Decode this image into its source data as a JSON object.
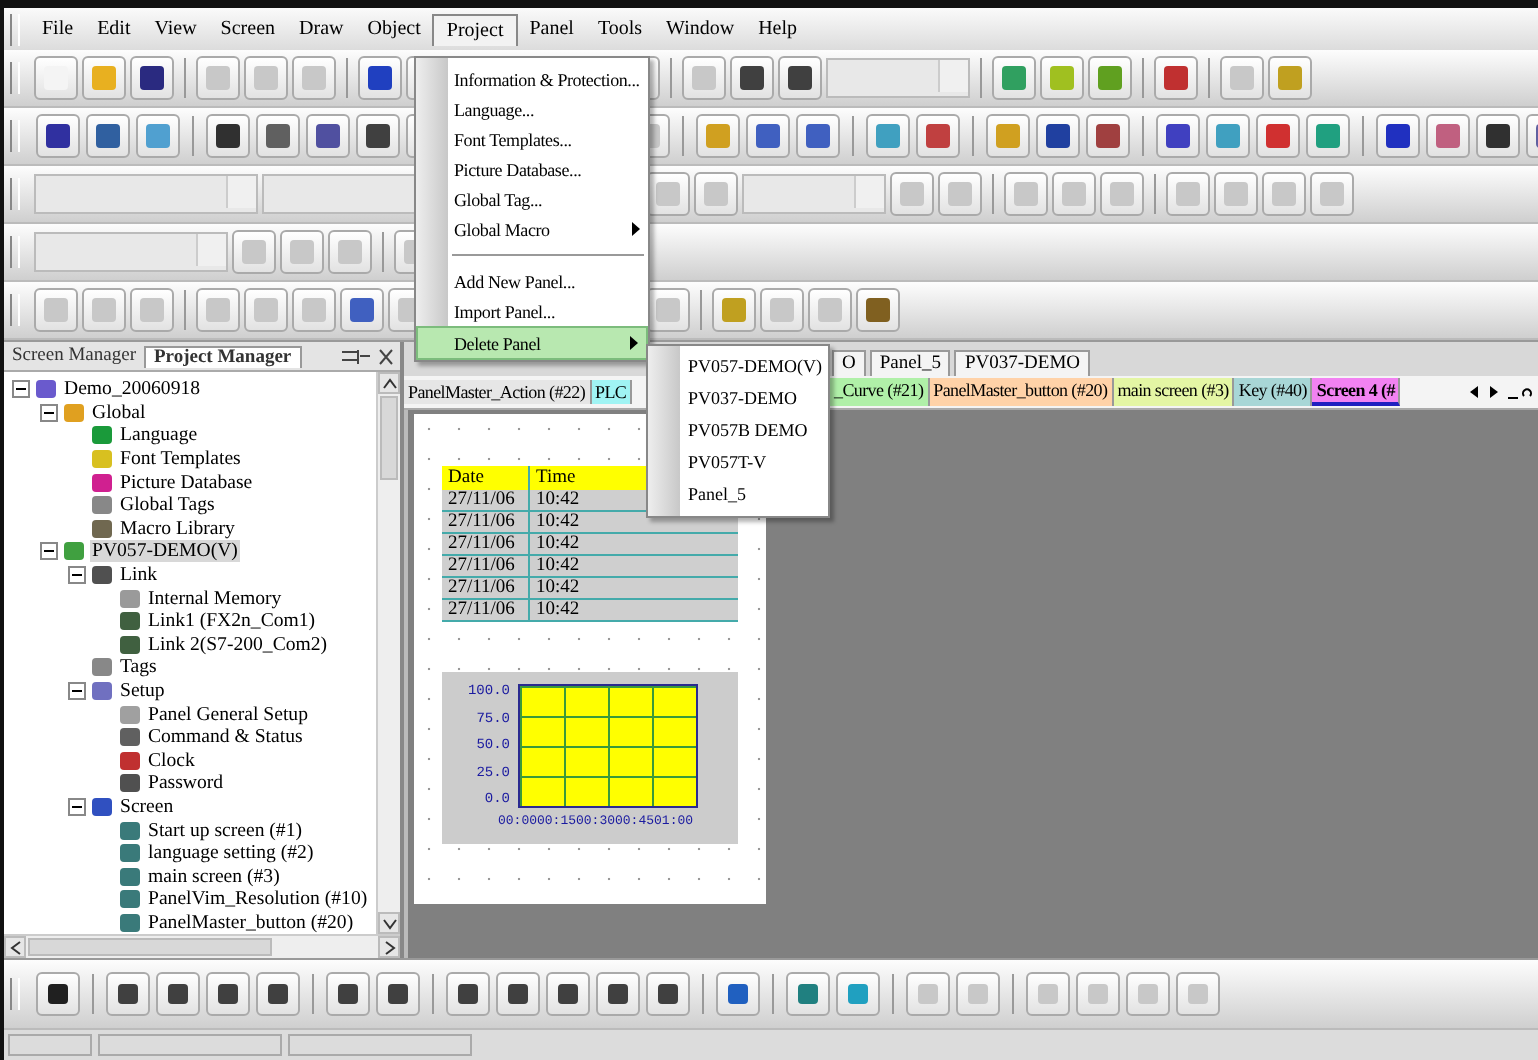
{
  "menu_bar": [
    {
      "label": "File",
      "selected": false
    },
    {
      "label": "Edit",
      "selected": false
    },
    {
      "label": "View",
      "selected": false
    },
    {
      "label": "Screen",
      "selected": false
    },
    {
      "label": "Draw",
      "selected": false
    },
    {
      "label": "Object",
      "selected": false
    },
    {
      "label": "Project",
      "selected": true
    },
    {
      "label": "Panel",
      "selected": false
    },
    {
      "label": "Tools",
      "selected": false
    },
    {
      "label": "Window",
      "selected": false
    },
    {
      "label": "Help",
      "selected": false
    }
  ],
  "project_menu": [
    {
      "label": "Information & Protection...",
      "kind": "item",
      "selected": false
    },
    {
      "label": "Language...",
      "kind": "item",
      "selected": false
    },
    {
      "label": "Font Templates...",
      "kind": "item",
      "selected": false
    },
    {
      "label": "Picture Database...",
      "kind": "item",
      "selected": false
    },
    {
      "label": "Global Tag...",
      "kind": "item",
      "selected": false
    },
    {
      "label": "Global Macro",
      "kind": "submenu",
      "selected": false
    },
    {
      "kind": "separator"
    },
    {
      "label": "Add New Panel...",
      "kind": "item",
      "selected": false
    },
    {
      "label": "Import Panel...",
      "kind": "item",
      "selected": false
    },
    {
      "label": "Delete Panel",
      "kind": "submenu",
      "selected": true
    }
  ],
  "delete_panel_submenu": [
    "PV057-DEMO(V)",
    "PV037-DEMO",
    "PV057B DEMO",
    "PV057T-V",
    "Panel_5"
  ],
  "manager_tabs": [
    {
      "label": "Screen Manager",
      "selected": false
    },
    {
      "label": "Project Manager",
      "selected": true
    }
  ],
  "project_tree": [
    {
      "label": "Demo_20060918",
      "kind": "project",
      "expanded": true,
      "selected": false,
      "children": [
        {
          "label": "Global",
          "kind": "globe",
          "expanded": true,
          "selected": false,
          "children": [
            {
              "label": "Language",
              "kind": "language",
              "selected": false
            },
            {
              "label": "Font Templates",
              "kind": "font",
              "selected": false
            },
            {
              "label": "Picture Database",
              "kind": "picture",
              "selected": false
            },
            {
              "label": "Global Tags",
              "kind": "tags",
              "selected": false
            },
            {
              "label": "Macro Library",
              "kind": "macro",
              "selected": false
            }
          ]
        },
        {
          "label": "PV057-DEMO(V)",
          "kind": "panel",
          "expanded": true,
          "selected": true,
          "children": [
            {
              "label": "Link",
              "kind": "link",
              "expanded": true,
              "selected": false,
              "children": [
                {
                  "label": "Internal Memory",
                  "kind": "memory",
                  "selected": false
                },
                {
                  "label": "Link1 (FX2n_Com1)",
                  "kind": "plc",
                  "selected": false
                },
                {
                  "label": "Link 2(S7-200_Com2)",
                  "kind": "plc",
                  "selected": false
                }
              ]
            },
            {
              "label": "Tags",
              "kind": "tags",
              "selected": false
            },
            {
              "label": "Setup",
              "kind": "setup",
              "expanded": true,
              "selected": false,
              "children": [
                {
                  "label": "Panel General Setup",
                  "kind": "form",
                  "selected": false
                },
                {
                  "label": "Command & Status",
                  "kind": "command",
                  "selected": false
                },
                {
                  "label": "Clock",
                  "kind": "clock",
                  "selected": false
                },
                {
                  "label": "Password",
                  "kind": "password",
                  "selected": false
                }
              ]
            },
            {
              "label": "Screen",
              "kind": "screens",
              "expanded": true,
              "selected": false,
              "children": [
                {
                  "label": "Start up screen (#1)",
                  "kind": "screen",
                  "selected": false
                },
                {
                  "label": "language setting (#2)",
                  "kind": "screen",
                  "selected": false
                },
                {
                  "label": "main screen (#3)",
                  "kind": "screen",
                  "selected": false
                },
                {
                  "label": "PanelVim_Resolution (#10)",
                  "kind": "screen",
                  "selected": false
                },
                {
                  "label": "PanelMaster_button (#20)",
                  "kind": "screen",
                  "selected": false
                }
              ]
            }
          ]
        }
      ]
    }
  ],
  "panel_tabs": [
    "O",
    "Panel_5",
    "PV037-DEMO"
  ],
  "screen_tabs": [
    {
      "label": "PanelMaster_Action (#22)",
      "color": "#e6e6e6",
      "selected": false
    },
    {
      "label": "PLC",
      "color": "#a0f4f4",
      "selected": false
    },
    {
      "label": "_Curve (#21)",
      "color": "#b0f0a8",
      "selected": false
    },
    {
      "label": "PanelMaster_button (#20)",
      "color": "#ffd2a8",
      "selected": false
    },
    {
      "label": "main screen (#3)",
      "color": "#e4f6a4",
      "selected": false
    },
    {
      "label": "Key (#40)",
      "color": "#a8d6d6",
      "selected": false
    },
    {
      "label": "Screen 4 (#",
      "color": "#f282f2",
      "selected": true
    }
  ],
  "alarm_table": {
    "columns": [
      "Date",
      "Time"
    ],
    "rows": [
      [
        "27/11/06",
        "10:42"
      ],
      [
        "27/11/06",
        "10:42"
      ],
      [
        "27/11/06",
        "10:42"
      ],
      [
        "27/11/06",
        "10:42"
      ],
      [
        "27/11/06",
        "10:42"
      ],
      [
        "27/11/06",
        "10:42"
      ]
    ]
  },
  "trend_graph": {
    "y_labels": [
      "100.0",
      "75.0",
      "50.0",
      "25.0",
      "0.0"
    ],
    "x_labels": "00:0000:1500:3000:4501:00"
  }
}
